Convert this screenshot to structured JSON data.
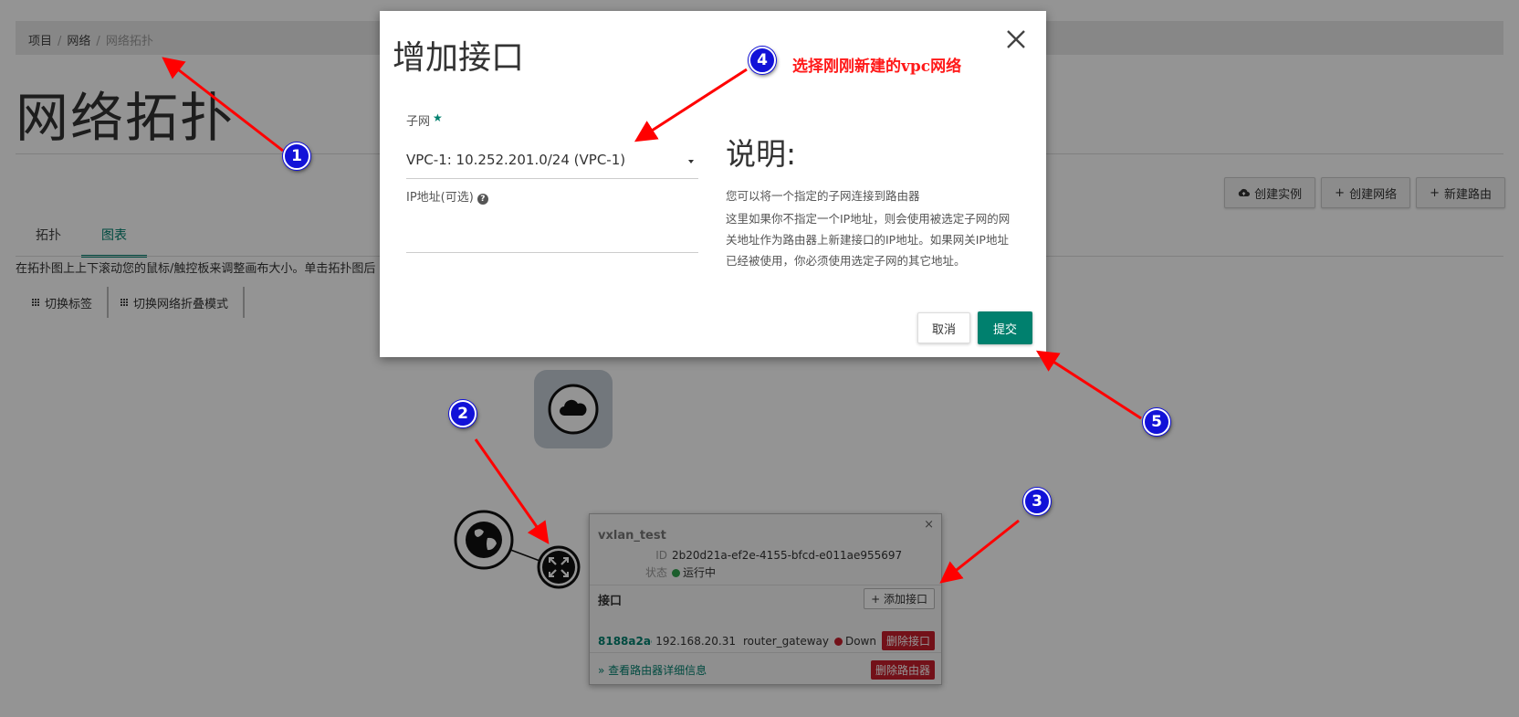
{
  "breadcrumb": {
    "item1": "项目",
    "item2": "网络",
    "item3": "网络拓扑"
  },
  "page": {
    "title": "网络拓扑",
    "hint": "在拓扑图上上下滚动您的鼠标/触控板来调整画布大小。单击拓扑图后"
  },
  "actions": {
    "create_instance": "创建实例",
    "create_network": "创建网络",
    "new_router": "新建路由"
  },
  "tabs": [
    {
      "label": "拓扑"
    },
    {
      "label": "图表"
    }
  ],
  "active_tab": "图表",
  "toggles": {
    "toggle_labels": "切换标签",
    "toggle_collapse": "切换网络折叠模式"
  },
  "router_card": {
    "name": "vxlan_test",
    "id_label": "ID",
    "id_value": "2b20d21a-ef2e-4155-bfcd-e011ae955697",
    "status_label": "状态",
    "status_value": "运行中",
    "ports_title": "接口",
    "add_port": "添加接口",
    "port": {
      "id": "8188a2ae-4...",
      "ip": "192.168.20.31",
      "type": "router_gateway",
      "status": "Down",
      "delete": "删除接口"
    },
    "details_link": "» 查看路由器详细信息",
    "delete_router": "删除路由器",
    "close": "×"
  },
  "modal": {
    "title": "增加接口",
    "subnet_label": "子网",
    "required_mark": "★",
    "subnet_value": "VPC-1: 10.252.201.0/24 (VPC-1)",
    "ip_label": "IP地址(可选)",
    "ip_value": "",
    "desc_title": "说明:",
    "desc_p1": "您可以将一个指定的子网连接到路由器",
    "desc_p2": "这里如果你不指定一个IP地址，则会使用被选定子网的网关地址作为路由器上新建接口的IP地址。如果网关IP地址已经被使用，你必须使用选定子网的其它地址。",
    "cancel": "取消",
    "submit": "提交"
  },
  "annotations": {
    "badges": [
      "1",
      "2",
      "3",
      "4",
      "5"
    ],
    "note": "选择刚刚新建的vpc网络",
    "arrow_color": "#ff0000",
    "badge_color": "#1212d8"
  },
  "colors": {
    "accent": "#00806e",
    "danger": "#c61e2b",
    "running": "#2fa24c"
  }
}
